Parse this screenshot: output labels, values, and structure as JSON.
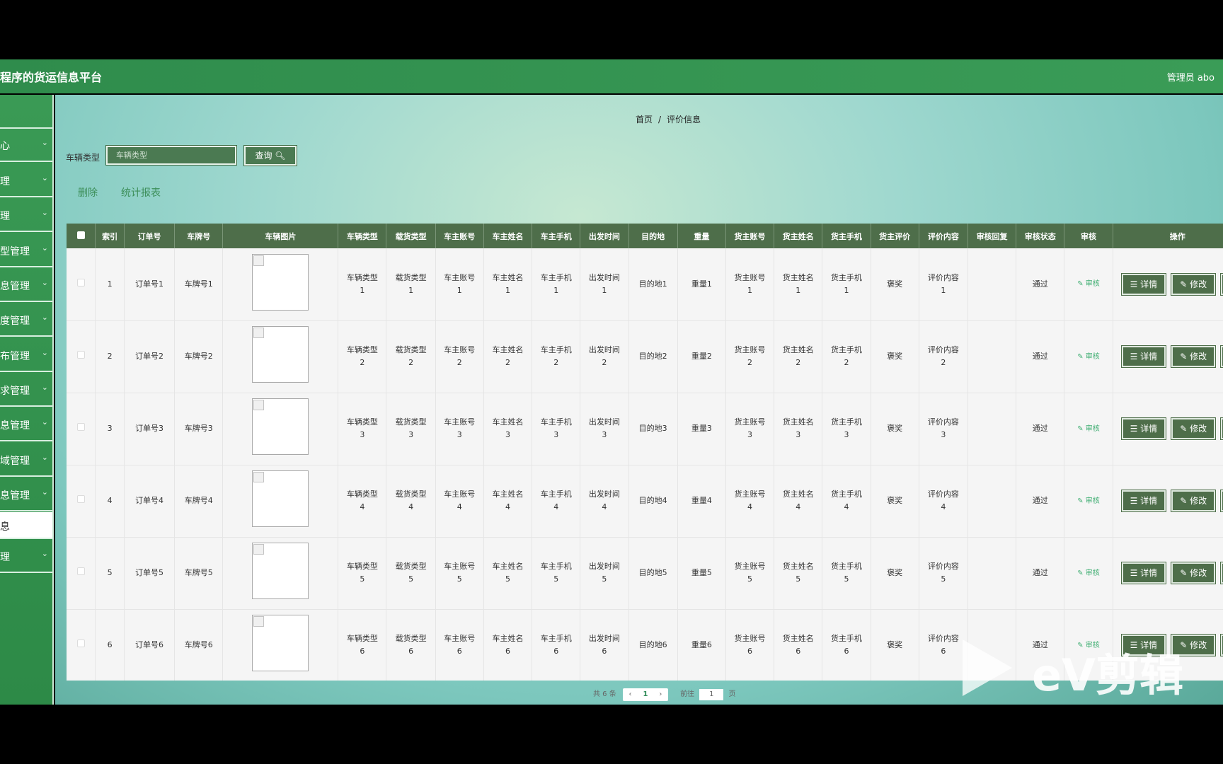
{
  "app": {
    "title": "程序的货运信息平台",
    "user": "管理员 abo"
  },
  "sidebar": {
    "items": [
      {
        "label": ""
      },
      {
        "label": "心"
      },
      {
        "label": "理"
      },
      {
        "label": "理"
      },
      {
        "label": "型管理"
      },
      {
        "label": "息管理"
      },
      {
        "label": "度管理"
      },
      {
        "label": "布管理"
      },
      {
        "label": "求管理"
      },
      {
        "label": "息管理"
      },
      {
        "label": "域管理"
      },
      {
        "label": "息管理"
      },
      {
        "label": "息"
      },
      {
        "label": "理"
      }
    ]
  },
  "breadcrumb": {
    "home": "首页",
    "sep": "/",
    "current": "评价信息"
  },
  "search": {
    "label": "车辆类型",
    "placeholder": "车辆类型",
    "button": "查询"
  },
  "actions": {
    "delete": "删除",
    "report": "统计报表"
  },
  "table": {
    "headers": [
      "索引",
      "订单号",
      "车牌号",
      "车辆图片",
      "车辆类型",
      "载货类型",
      "车主账号",
      "车主姓名",
      "车主手机",
      "出发时间",
      "目的地",
      "重量",
      "货主账号",
      "货主姓名",
      "货主手机",
      "货主评价",
      "评价内容",
      "审核回复",
      "审核状态",
      "审核",
      "操作"
    ],
    "rows": [
      {
        "idx": "1",
        "order": "订单号1",
        "plate": "车牌号1",
        "vtype": [
          "车辆类型",
          "1"
        ],
        "ctype": [
          "载货类型",
          "1"
        ],
        "oacct": [
          "车主账号",
          "1"
        ],
        "oname": [
          "车主姓名",
          "1"
        ],
        "ophone": [
          "车主手机",
          "1"
        ],
        "dep": [
          "出发时间",
          "1"
        ],
        "dest": "目的地1",
        "weight": "重量1",
        "sacct": [
          "货主账号",
          "1"
        ],
        "sname": [
          "货主姓名",
          "1"
        ],
        "sphone": [
          "货主手机",
          "1"
        ],
        "rating": "褒奖",
        "content": [
          "评价内容",
          "1"
        ],
        "reply": "",
        "status": "通过"
      },
      {
        "idx": "2",
        "order": "订单号2",
        "plate": "车牌号2",
        "vtype": [
          "车辆类型",
          "2"
        ],
        "ctype": [
          "载货类型",
          "2"
        ],
        "oacct": [
          "车主账号",
          "2"
        ],
        "oname": [
          "车主姓名",
          "2"
        ],
        "ophone": [
          "车主手机",
          "2"
        ],
        "dep": [
          "出发时间",
          "2"
        ],
        "dest": "目的地2",
        "weight": "重量2",
        "sacct": [
          "货主账号",
          "2"
        ],
        "sname": [
          "货主姓名",
          "2"
        ],
        "sphone": [
          "货主手机",
          "2"
        ],
        "rating": "褒奖",
        "content": [
          "评价内容",
          "2"
        ],
        "reply": "",
        "status": "通过"
      },
      {
        "idx": "3",
        "order": "订单号3",
        "plate": "车牌号3",
        "vtype": [
          "车辆类型",
          "3"
        ],
        "ctype": [
          "载货类型",
          "3"
        ],
        "oacct": [
          "车主账号",
          "3"
        ],
        "oname": [
          "车主姓名",
          "3"
        ],
        "ophone": [
          "车主手机",
          "3"
        ],
        "dep": [
          "出发时间",
          "3"
        ],
        "dest": "目的地3",
        "weight": "重量3",
        "sacct": [
          "货主账号",
          "3"
        ],
        "sname": [
          "货主姓名",
          "3"
        ],
        "sphone": [
          "货主手机",
          "3"
        ],
        "rating": "褒奖",
        "content": [
          "评价内容",
          "3"
        ],
        "reply": "",
        "status": "通过"
      },
      {
        "idx": "4",
        "order": "订单号4",
        "plate": "车牌号4",
        "vtype": [
          "车辆类型",
          "4"
        ],
        "ctype": [
          "载货类型",
          "4"
        ],
        "oacct": [
          "车主账号",
          "4"
        ],
        "oname": [
          "车主姓名",
          "4"
        ],
        "ophone": [
          "车主手机",
          "4"
        ],
        "dep": [
          "出发时间",
          "4"
        ],
        "dest": "目的地4",
        "weight": "重量4",
        "sacct": [
          "货主账号",
          "4"
        ],
        "sname": [
          "货主姓名",
          "4"
        ],
        "sphone": [
          "货主手机",
          "4"
        ],
        "rating": "褒奖",
        "content": [
          "评价内容",
          "4"
        ],
        "reply": "",
        "status": "通过"
      },
      {
        "idx": "5",
        "order": "订单号5",
        "plate": "车牌号5",
        "vtype": [
          "车辆类型",
          "5"
        ],
        "ctype": [
          "载货类型",
          "5"
        ],
        "oacct": [
          "车主账号",
          "5"
        ],
        "oname": [
          "车主姓名",
          "5"
        ],
        "ophone": [
          "车主手机",
          "5"
        ],
        "dep": [
          "出发时间",
          "5"
        ],
        "dest": "目的地5",
        "weight": "重量5",
        "sacct": [
          "货主账号",
          "5"
        ],
        "sname": [
          "货主姓名",
          "5"
        ],
        "sphone": [
          "货主手机",
          "5"
        ],
        "rating": "褒奖",
        "content": [
          "评价内容",
          "5"
        ],
        "reply": "",
        "status": "通过"
      },
      {
        "idx": "6",
        "order": "订单号6",
        "plate": "车牌号6",
        "vtype": [
          "车辆类型",
          "6"
        ],
        "ctype": [
          "载货类型",
          "6"
        ],
        "oacct": [
          "车主账号",
          "6"
        ],
        "oname": [
          "车主姓名",
          "6"
        ],
        "ophone": [
          "车主手机",
          "6"
        ],
        "dep": [
          "出发时间",
          "6"
        ],
        "dest": "目的地6",
        "weight": "重量6",
        "sacct": [
          "货主账号",
          "6"
        ],
        "sname": [
          "货主姓名",
          "6"
        ],
        "sphone": [
          "货主手机",
          "6"
        ],
        "rating": "褒奖",
        "content": [
          "评价内容",
          "6"
        ],
        "reply": "",
        "status": "通过"
      }
    ],
    "audit_label": "审核",
    "detail_label": "详情",
    "edit_label": "修改"
  },
  "pager": {
    "total": "共 6 条",
    "current": "1",
    "goto_prefix": "前往",
    "goto_value": "1",
    "goto_suffix": "页"
  },
  "watermark": {
    "text": "eV剪辑"
  },
  "colors": {
    "header_green": "#2f8c4c",
    "table_header": "#4e6e4a",
    "link_green": "#3d8f5a"
  }
}
